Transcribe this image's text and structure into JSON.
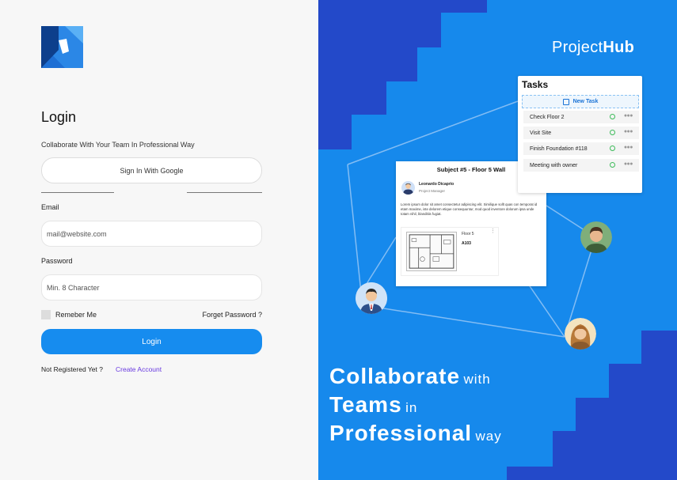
{
  "login": {
    "title": "Login",
    "subtitle": "Collaborate With Your Team In Professional Way",
    "google_label": "Sign In With Google",
    "email_label": "Email",
    "email_placeholder": "mail@website.com",
    "password_label": "Password",
    "password_placeholder": "Min. 8 Character",
    "remember_label": "Remeber Me",
    "forgot_label": "Forget Password ?",
    "login_button": "Login",
    "not_registered": "Not Registered Yet ?",
    "create_account": "Create Account"
  },
  "brand": {
    "light": "Project",
    "bold": "Hub"
  },
  "tasks": {
    "title": "Tasks",
    "new_task": "New Task",
    "items": [
      "Check Floor 2",
      "Visit Site",
      "Finish Foundation #118",
      "Meeting with owner"
    ]
  },
  "subject": {
    "title": "Subject #5 - Floor 5 Wall",
    "author_name": "Leonardo Dicaprio",
    "author_role": "Project Manager",
    "body": "Lorem ipsum dolor sit amet consectetur adipiscing elit. Similique sollt quas con temporat id etam maxime, iste delorem etique consequuntur, mod quod inventore dolorum ipsa unde totam nihil, blanditiis fugiat.",
    "attachment_floor": "Floor 5",
    "attachment_code": "A103"
  },
  "tagline": {
    "line1_big": "Collaborate",
    "line1_small": "with",
    "line2_big": "Teams",
    "line2_small": "in",
    "line3_big": "Professional",
    "line3_small": "way"
  },
  "colors": {
    "accent": "#168cef",
    "panel_blue": "#1689ec",
    "step_dark": "#2349c9",
    "link_purple": "#6a3be0"
  }
}
